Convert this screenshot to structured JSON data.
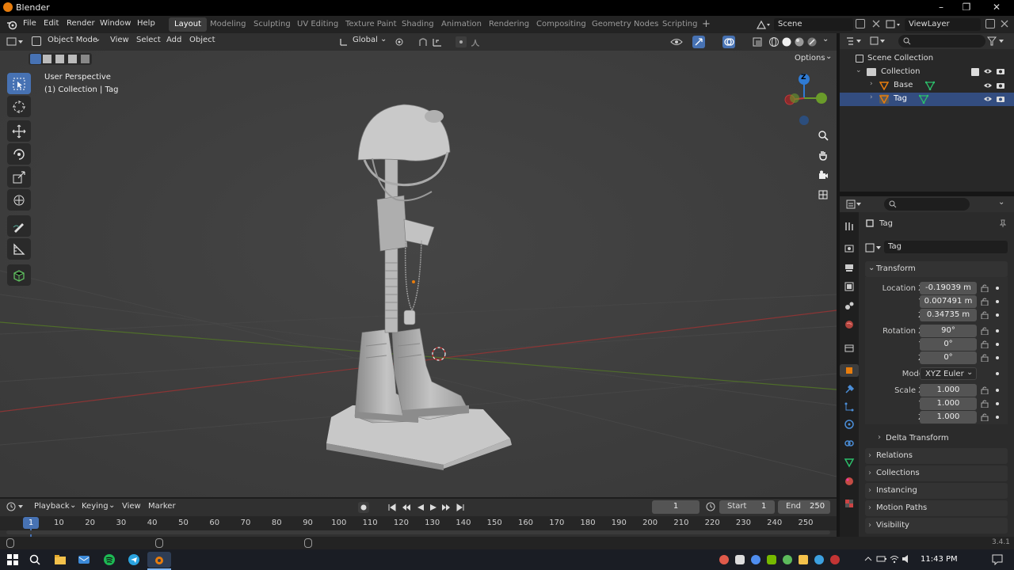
{
  "window": {
    "title": "Blender"
  },
  "menu": {
    "items": [
      "File",
      "Edit",
      "Render",
      "Window",
      "Help"
    ],
    "workspaces": [
      "Layout",
      "Modeling",
      "Sculpting",
      "UV Editing",
      "Texture Paint",
      "Shading",
      "Animation",
      "Rendering",
      "Compositing",
      "Geometry Nodes",
      "Scripting"
    ],
    "active_workspace": "Layout",
    "scene": "Scene",
    "view_layer": "ViewLayer"
  },
  "viewport": {
    "mode": "Object Mode",
    "menus": [
      "View",
      "Select",
      "Add",
      "Object"
    ],
    "transform_orientation": "Global",
    "options_label": "Options",
    "overlay_title": "User Perspective",
    "overlay_subtitle": "(1) Collection | Tag",
    "gizmo_axis_label": "Z"
  },
  "outliner": {
    "scene_collection": "Scene Collection",
    "collection": "Collection",
    "objects": [
      "Base",
      "Tag"
    ]
  },
  "properties": {
    "object_name": "Tag",
    "data_name": "Tag",
    "transform_label": "Transform",
    "location_label": "Location X",
    "location": {
      "x": "-0.19039 m",
      "y": "0.007491 m",
      "z": "0.34735 m"
    },
    "rotation_label": "Rotation X",
    "rotation": {
      "x": "90°",
      "y": "0°",
      "z": "0°"
    },
    "mode_label": "Mode",
    "mode": "XYZ Euler",
    "scale_label": "Scale X",
    "scale": {
      "x": "1.000",
      "y": "1.000",
      "z": "1.000"
    },
    "axis_y": "Y",
    "axis_z": "Z",
    "sections": [
      "Delta Transform",
      "Relations",
      "Collections",
      "Instancing",
      "Motion Paths",
      "Visibility"
    ]
  },
  "timeline": {
    "menus": [
      "Playback",
      "Keying",
      "View",
      "Marker"
    ],
    "current_frame": "1",
    "start_label": "Start",
    "start": "1",
    "end_label": "End",
    "end": "250",
    "ticks": [
      "1",
      "10",
      "20",
      "30",
      "40",
      "50",
      "60",
      "70",
      "80",
      "90",
      "100",
      "110",
      "120",
      "130",
      "140",
      "150",
      "160",
      "170",
      "180",
      "190",
      "200",
      "210",
      "220",
      "230",
      "240",
      "250"
    ]
  },
  "status": {
    "version": "3.4.1"
  },
  "taskbar": {
    "time": "11:43 PM"
  },
  "colors": {
    "accent": "#4772b3",
    "object_orange": "#e87d0d",
    "axis_x": "#c0393b",
    "axis_y": "#6a9b2a",
    "axis_z": "#2f7bd4"
  }
}
